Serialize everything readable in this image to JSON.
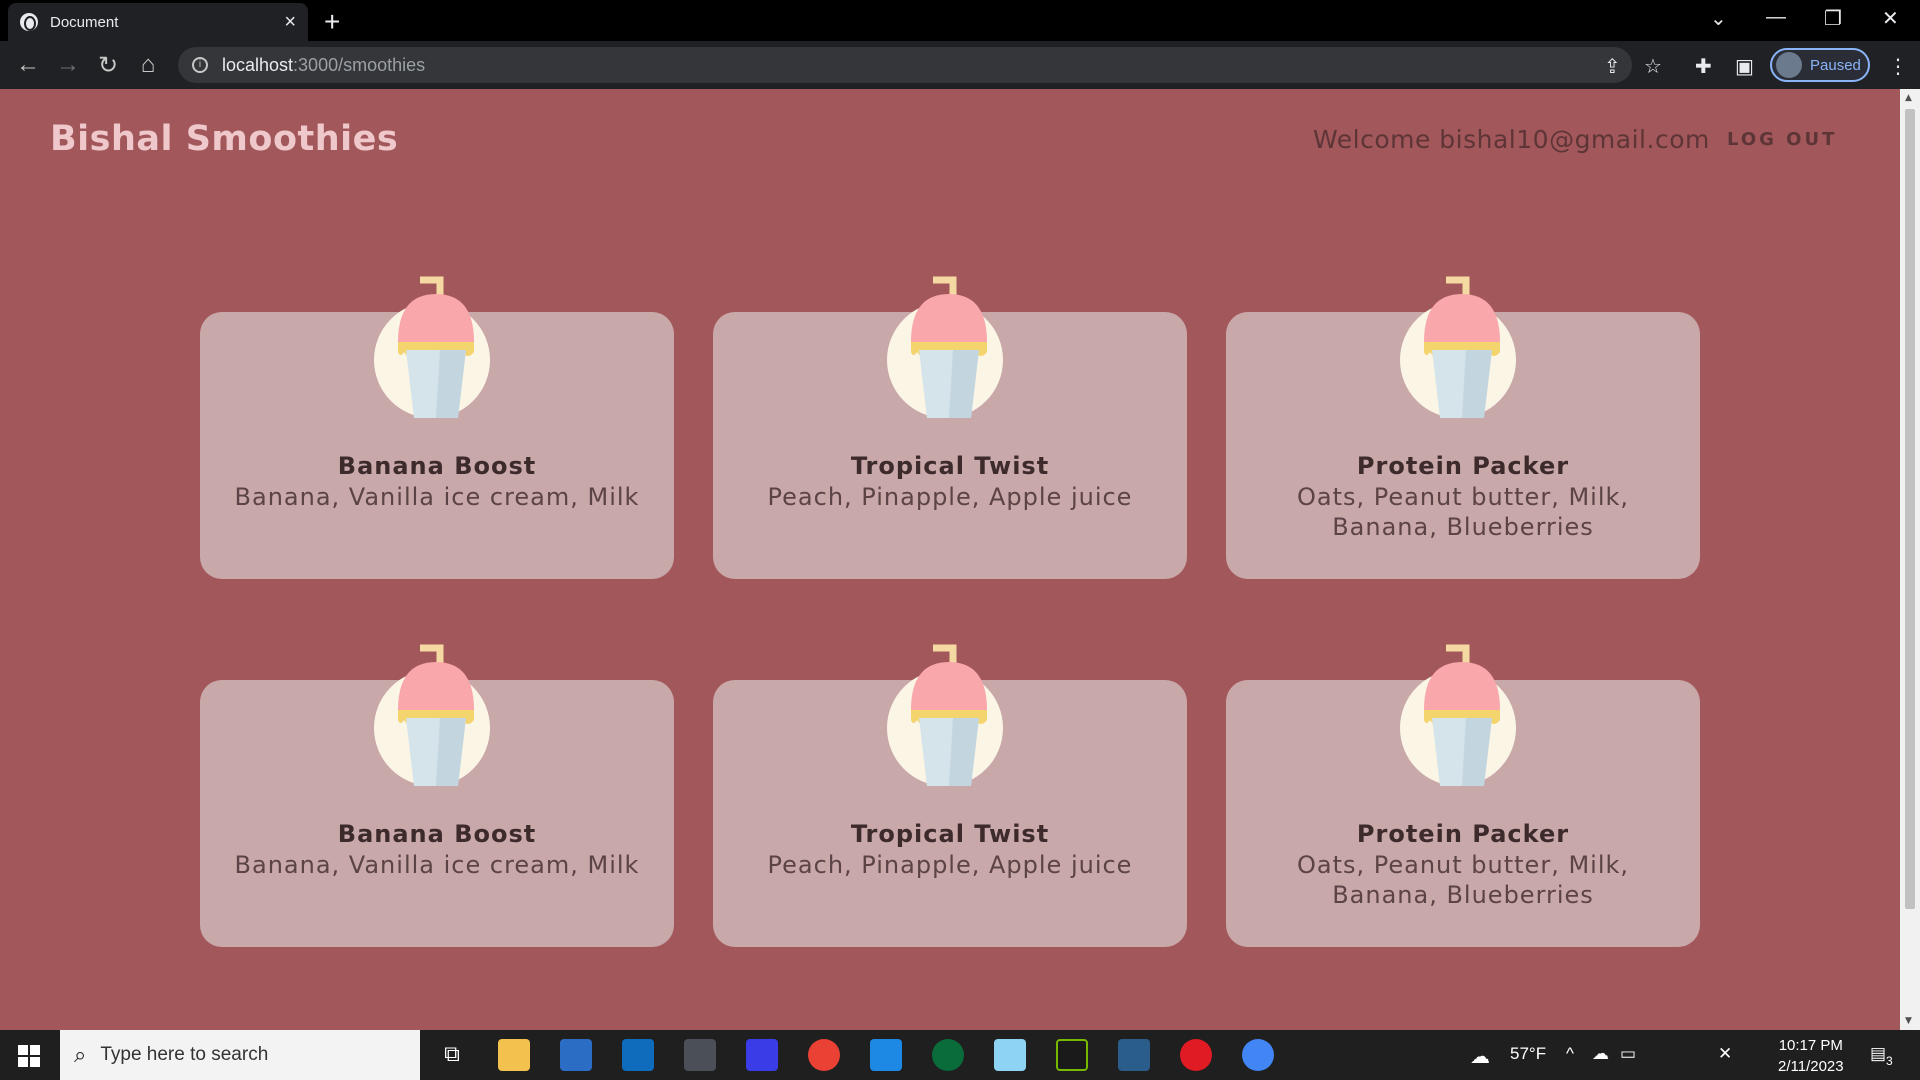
{
  "browser": {
    "tab_title": "Document",
    "url_host": "localhost",
    "url_path": ":3000/smoothies",
    "profile_label": "Paused"
  },
  "header": {
    "brand": "Bishal Smoothies",
    "welcome": "Welcome bishal10@gmail.com",
    "logout": "LOG OUT"
  },
  "smoothies": [
    {
      "name": "Banana Boost",
      "ingredients": "Banana, Vanilla ice cream, Milk"
    },
    {
      "name": "Tropical Twist",
      "ingredients": "Peach, Pinapple, Apple juice"
    },
    {
      "name": "Protein Packer",
      "ingredients": "Oats, Peanut butter, Milk, Banana, Blueberries"
    },
    {
      "name": "Banana Boost",
      "ingredients": "Banana, Vanilla ice cream, Milk"
    },
    {
      "name": "Tropical Twist",
      "ingredients": "Peach, Pinapple, Apple juice"
    },
    {
      "name": "Protein Packer",
      "ingredients": "Oats, Peanut butter, Milk, Banana, Blueberries"
    }
  ],
  "taskbar": {
    "search_placeholder": "Type here to search",
    "weather": "57°F",
    "time": "10:17 PM",
    "date": "2/11/2023",
    "notifications": "3"
  },
  "colors": {
    "page_bg": "#a2575a",
    "card_bg": "#c9a8a9",
    "brand_text": "#efc8cc"
  }
}
